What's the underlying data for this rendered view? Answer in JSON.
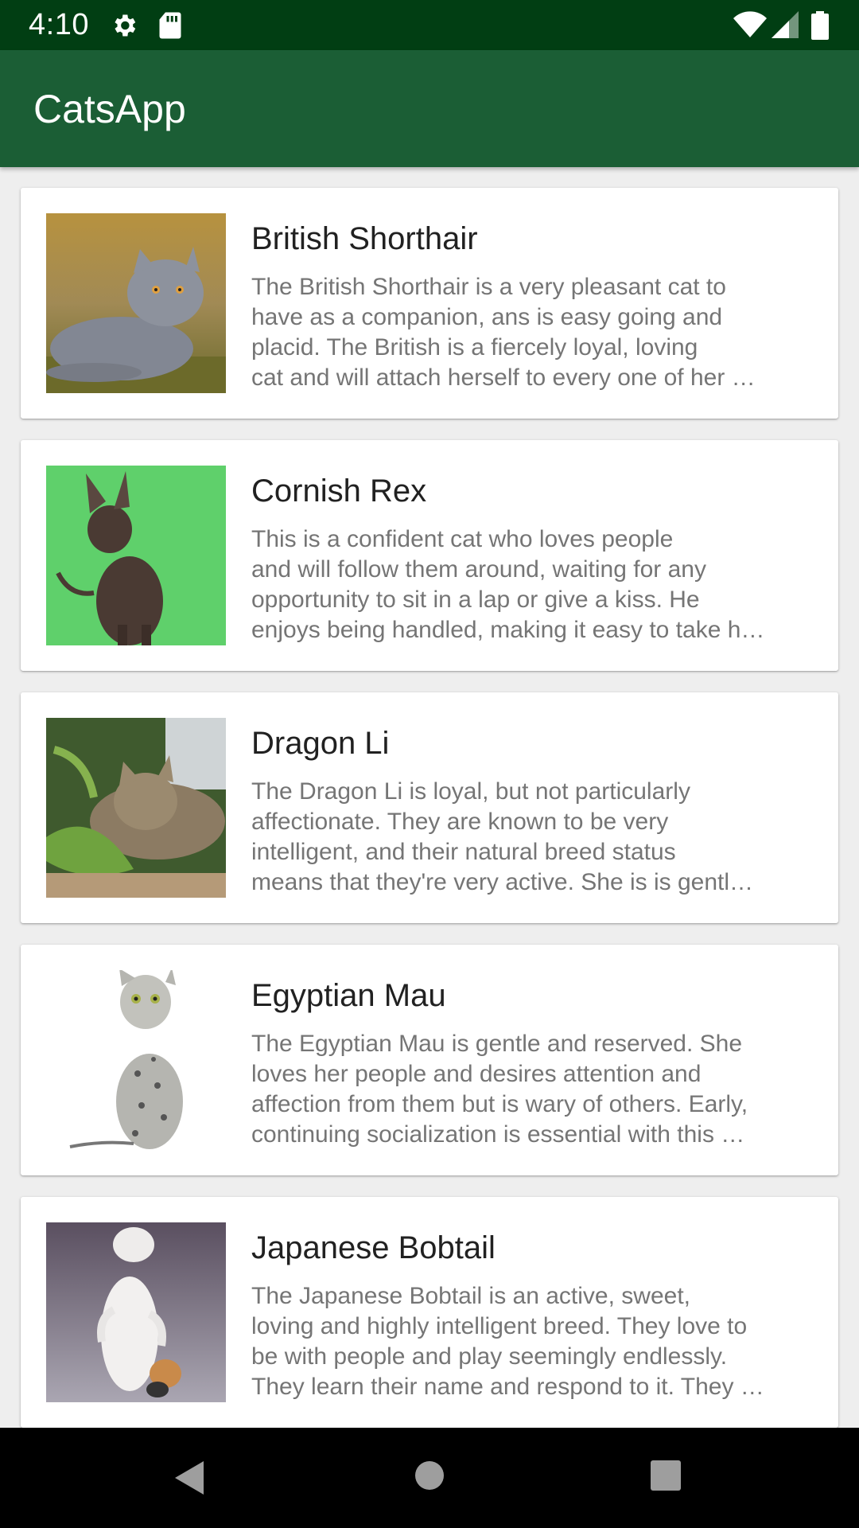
{
  "status_bar": {
    "time": "4:10",
    "icons": [
      "gear-icon",
      "sd-card-icon",
      "wifi-icon",
      "cell-signal-icon",
      "battery-icon"
    ]
  },
  "app_bar": {
    "title": "CatsApp",
    "color": "#1b5e35"
  },
  "cats": [
    {
      "name": "British Shorthair",
      "description": "The British Shorthair is a very pleasant cat to\nhave as a companion, ans is easy going and\nplacid. The British is a fiercely loyal, loving\ncat and will attach herself to every one of her …"
    },
    {
      "name": "Cornish Rex",
      "description": "This is a confident cat who loves people\nand will follow them around, waiting for any\nopportunity to sit in a lap or give a kiss. He\nenjoys being handled, making it easy to take h…"
    },
    {
      "name": "Dragon Li",
      "description": "The Dragon Li is loyal, but not particularly\naffectionate. They are known to be very\nintelligent, and their natural breed status\nmeans that they're very active. She is is gentl…"
    },
    {
      "name": "Egyptian Mau",
      "description": "The Egyptian Mau is gentle and reserved. She\nloves her people and desires attention and\naffection from them but is wary of others. Early,\ncontinuing socialization is essential with this …"
    },
    {
      "name": "Japanese Bobtail",
      "description": "The Japanese Bobtail is an active, sweet,\nloving and highly intelligent breed. They love to\nbe with people and play seemingly endlessly.\nThey learn their name and respond to it. They …"
    }
  ],
  "nav_bar": {
    "buttons": [
      "back-icon",
      "home-icon",
      "recents-icon"
    ]
  }
}
